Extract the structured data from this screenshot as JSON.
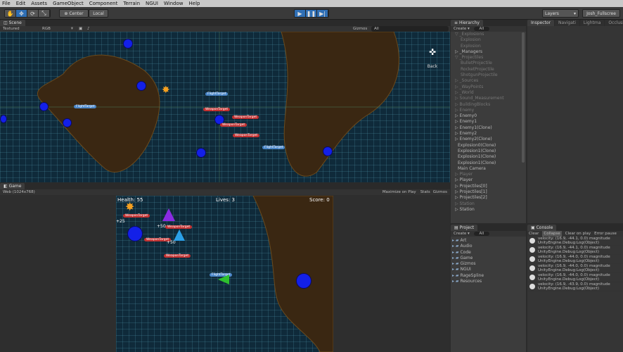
{
  "menu": [
    "File",
    "Edit",
    "Assets",
    "GameObject",
    "Component",
    "Terrain",
    "NGUI",
    "Window",
    "Help"
  ],
  "toolbar": {
    "pivot": "Center",
    "space": "Local",
    "layers": "Layers",
    "layout": "Josh_Fullscree"
  },
  "scene": {
    "tab": "Scene",
    "shading": "Textured",
    "mode": "RGB",
    "gizmos": "Gizmos",
    "all": "All",
    "back": "Back"
  },
  "game": {
    "tab": "Game",
    "aspect": "Web (1024x768)",
    "maximize": "Maximize on Play",
    "stats": "Stats",
    "gizmos": "Gizmos",
    "health": "Health: 55",
    "lives": "Lives: 3",
    "score": "Score: 0"
  },
  "hierarchy": {
    "tab": "Hierarchy",
    "create": "Create",
    "all": "All",
    "items": [
      {
        "t": "▽ _Explosions",
        "d": 1,
        "dim": true
      },
      {
        "t": "Explosion",
        "d": 3,
        "dim": true
      },
      {
        "t": "Explosion",
        "d": 3,
        "dim": true
      },
      {
        "t": "▷ _Managers",
        "d": 1
      },
      {
        "t": "▽ _Projectiles",
        "d": 1,
        "dim": true
      },
      {
        "t": "BulletProjectile",
        "d": 3,
        "dim": true
      },
      {
        "t": "RocketProjectile",
        "d": 3,
        "dim": true
      },
      {
        "t": "ShotgunProjectile",
        "d": 3,
        "dim": true
      },
      {
        "t": "▷ _Sources",
        "d": 1,
        "dim": true
      },
      {
        "t": "▷ _WayPoints",
        "d": 1,
        "dim": true
      },
      {
        "t": "▷ _World",
        "d": 1,
        "dim": true
      },
      {
        "t": "▷ Sound_Measurement",
        "d": 1,
        "dim": true
      },
      {
        "t": "▷ BuildingBlocks",
        "d": 1,
        "dim": true
      },
      {
        "t": "▷ Enemy",
        "d": 1,
        "dim": true
      },
      {
        "t": "▷ Enemy0",
        "d": 1
      },
      {
        "t": "▷ Enemy1",
        "d": 1
      },
      {
        "t": "▷ Enemy1(Clone)",
        "d": 1
      },
      {
        "t": "▷ Enemy2",
        "d": 1
      },
      {
        "t": "▷ Enemy2(Clone)",
        "d": 1
      },
      {
        "t": "Explosion0(Clone)",
        "d": 2
      },
      {
        "t": "Explosion1(Clone)",
        "d": 2
      },
      {
        "t": "Explosion1(Clone)",
        "d": 2
      },
      {
        "t": "Explosion1(Clone)",
        "d": 2
      },
      {
        "t": "Main Camera",
        "d": 2
      },
      {
        "t": "▷ Player",
        "d": 1,
        "dim": true
      },
      {
        "t": "▷ Player",
        "d": 1
      },
      {
        "t": "▷ Projectiles[0]",
        "d": 1
      },
      {
        "t": "▷ Projectiles[1]",
        "d": 1
      },
      {
        "t": "▷ Projectiles[2]",
        "d": 1
      },
      {
        "t": "▷ Station",
        "d": 1,
        "dim": true
      },
      {
        "t": "▷ Station",
        "d": 1
      }
    ]
  },
  "inspector": {
    "tabs": [
      "Inspector",
      "Navigati",
      "Lightma",
      "Occlusi"
    ]
  },
  "project": {
    "tab": "Project",
    "create": "Create",
    "all": "All",
    "folders": [
      "Art",
      "Audio",
      "Code",
      "Game",
      "Gizmos",
      "NGUI",
      "RageSpline",
      "Resources"
    ]
  },
  "console": {
    "tab": "Console",
    "buttons": [
      "Clear",
      "Collapse",
      "Clear on play",
      "Error pause"
    ],
    "logs": [
      {
        "a": "velocity: (16.9, -44.1, 0.0) magnitude",
        "b": "UnityEngine.Debug:Log(Object)"
      },
      {
        "a": "velocity: (16.9, -44.1, 0.0) magnitude",
        "b": "UnityEngine.Debug:Log(Object)"
      },
      {
        "a": "velocity: (16.9, -44.0, 0.0) magnitude",
        "b": "UnityEngine.Debug:Log(Object)"
      },
      {
        "a": "velocity: (16.9, -44.0, 0.0) magnitude",
        "b": "UnityEngine.Debug:Log(Object)"
      },
      {
        "a": "velocity: (16.9, -44.0, 0.0) magnitude",
        "b": "UnityEngine.Debug:Log(Object)"
      },
      {
        "a": "velocity: (16.9, -43.9, 0.0) magnitude",
        "b": "UnityEngine.Debug:Log(Object)"
      }
    ]
  },
  "labels": {
    "flight": "FlightTarget",
    "weapon": "WeaponTarget",
    "plus25": "+25",
    "plus50": "+50"
  }
}
